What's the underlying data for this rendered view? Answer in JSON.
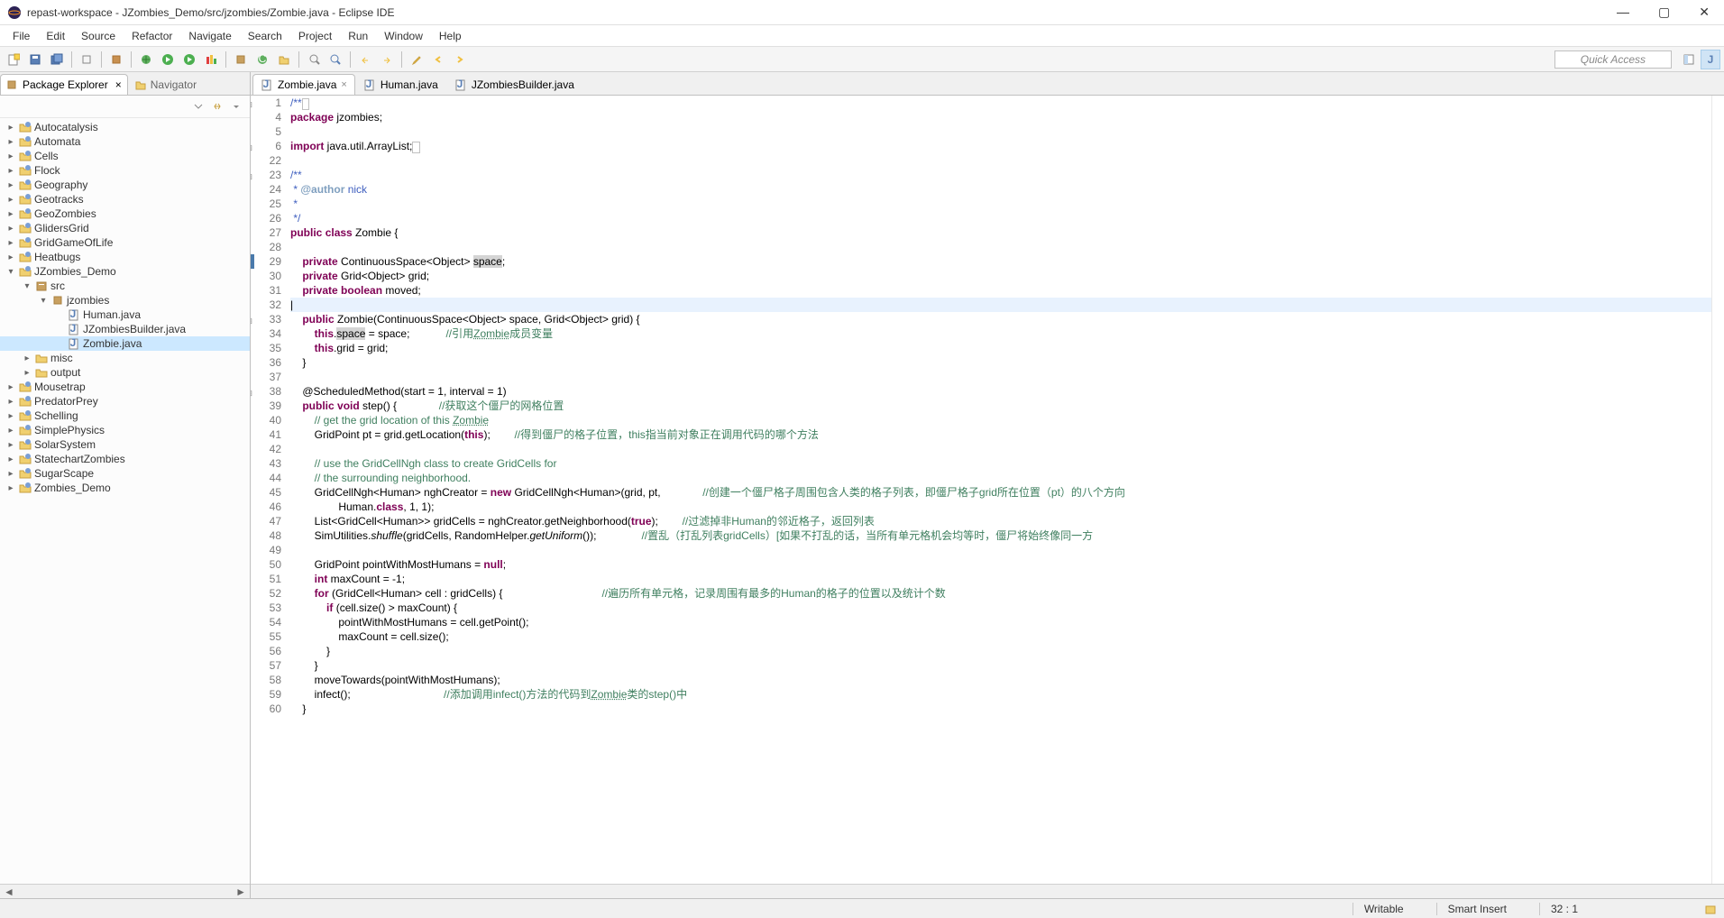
{
  "window": {
    "title": "repast-workspace - JZombies_Demo/src/jzombies/Zombie.java - Eclipse IDE"
  },
  "menu": [
    "File",
    "Edit",
    "Source",
    "Refactor",
    "Navigate",
    "Search",
    "Project",
    "Run",
    "Window",
    "Help"
  ],
  "quick_access": "Quick Access",
  "sidebar": {
    "tabs": [
      {
        "label": "Package Explorer",
        "active": true
      },
      {
        "label": "Navigator",
        "active": false
      }
    ],
    "projects": [
      {
        "label": "Autocatalysis",
        "expanded": false,
        "depth": 0,
        "icon": "project"
      },
      {
        "label": "Automata",
        "expanded": false,
        "depth": 0,
        "icon": "project"
      },
      {
        "label": "Cells",
        "expanded": false,
        "depth": 0,
        "icon": "project"
      },
      {
        "label": "Flock",
        "expanded": false,
        "depth": 0,
        "icon": "project"
      },
      {
        "label": "Geography",
        "expanded": false,
        "depth": 0,
        "icon": "project"
      },
      {
        "label": "Geotracks",
        "expanded": false,
        "depth": 0,
        "icon": "project"
      },
      {
        "label": "GeoZombies",
        "expanded": false,
        "depth": 0,
        "icon": "project"
      },
      {
        "label": "GlidersGrid",
        "expanded": false,
        "depth": 0,
        "icon": "project"
      },
      {
        "label": "GridGameOfLife",
        "expanded": false,
        "depth": 0,
        "icon": "project"
      },
      {
        "label": "Heatbugs",
        "expanded": false,
        "depth": 0,
        "icon": "project"
      },
      {
        "label": "JZombies_Demo",
        "expanded": true,
        "depth": 0,
        "icon": "project"
      },
      {
        "label": "src",
        "expanded": true,
        "depth": 1,
        "icon": "src"
      },
      {
        "label": "jzombies",
        "expanded": true,
        "depth": 2,
        "icon": "package"
      },
      {
        "label": "Human.java",
        "expanded": null,
        "depth": 3,
        "icon": "java"
      },
      {
        "label": "JZombiesBuilder.java",
        "expanded": null,
        "depth": 3,
        "icon": "java"
      },
      {
        "label": "Zombie.java",
        "expanded": null,
        "depth": 3,
        "icon": "java",
        "selected": true
      },
      {
        "label": "misc",
        "expanded": false,
        "depth": 1,
        "icon": "folder"
      },
      {
        "label": "output",
        "expanded": false,
        "depth": 1,
        "icon": "folder"
      },
      {
        "label": "Mousetrap",
        "expanded": false,
        "depth": 0,
        "icon": "project"
      },
      {
        "label": "PredatorPrey",
        "expanded": false,
        "depth": 0,
        "icon": "project"
      },
      {
        "label": "Schelling",
        "expanded": false,
        "depth": 0,
        "icon": "project"
      },
      {
        "label": "SimplePhysics",
        "expanded": false,
        "depth": 0,
        "icon": "project"
      },
      {
        "label": "SolarSystem",
        "expanded": false,
        "depth": 0,
        "icon": "project"
      },
      {
        "label": "StatechartZombies",
        "expanded": false,
        "depth": 0,
        "icon": "project"
      },
      {
        "label": "SugarScape",
        "expanded": false,
        "depth": 0,
        "icon": "project"
      },
      {
        "label": "Zombies_Demo",
        "expanded": false,
        "depth": 0,
        "icon": "project"
      }
    ]
  },
  "editor": {
    "tabs": [
      {
        "label": "Zombie.java",
        "active": true
      },
      {
        "label": "Human.java",
        "active": false
      },
      {
        "label": "JZombiesBuilder.java",
        "active": false
      }
    ],
    "lines": [
      {
        "n": "1",
        "fold": "+",
        "html": "<span class='jd'>/**</span><span class='fd'>&nbsp;</span>"
      },
      {
        "n": "4",
        "html": "<span class='kw'>package</span> jzombies;"
      },
      {
        "n": "5",
        "html": ""
      },
      {
        "n": "6",
        "fold": "+",
        "html": "<span class='kw'>import</span> java.util.ArrayList;<span class='fd'>&nbsp;</span>"
      },
      {
        "n": "22",
        "html": ""
      },
      {
        "n": "23",
        "fold": "-",
        "html": "<span class='jd'>/**</span>"
      },
      {
        "n": "24",
        "html": "<span class='jd'> * </span><span class='jtag'>@author</span><span class='jd'> nick</span>"
      },
      {
        "n": "25",
        "html": "<span class='jd'> *</span>"
      },
      {
        "n": "26",
        "html": "<span class='jd'> */</span>"
      },
      {
        "n": "27",
        "html": "<span class='kw'>public</span> <span class='kw'>class</span> Zombie {"
      },
      {
        "n": "28",
        "html": ""
      },
      {
        "n": "29",
        "ovw": true,
        "html": "    <span class='kw'>private</span> ContinuousSpace&lt;Object&gt; <span class='hl'>space</span>;"
      },
      {
        "n": "30",
        "html": "    <span class='kw'>private</span> Grid&lt;Object&gt; grid;"
      },
      {
        "n": "31",
        "warn": true,
        "html": "    <span class='kw'>private</span> <span class='kw'>boolean</span> moved;"
      },
      {
        "n": "32",
        "current": true,
        "html": "|"
      },
      {
        "n": "33",
        "fold": "-",
        "html": "    <span class='kw'>public</span> Zombie(ContinuousSpace&lt;Object&gt; space, Grid&lt;Object&gt; grid) {"
      },
      {
        "n": "34",
        "html": "        <span class='kw'>this</span>.<span class='hl'>space</span> = space;            <span class='cm'>//引用<span class='un'>Zombie</span>成员变量</span>"
      },
      {
        "n": "35",
        "html": "        <span class='kw'>this</span>.grid = grid;"
      },
      {
        "n": "36",
        "html": "    }"
      },
      {
        "n": "37",
        "html": ""
      },
      {
        "n": "38",
        "fold": "-",
        "html": "    @ScheduledMethod(start = 1, interval = 1)"
      },
      {
        "n": "39",
        "html": "    <span class='kw'>public</span> <span class='kw'>void</span> step() {              <span class='cm'>//获取这个僵尸的网格位置</span>"
      },
      {
        "n": "40",
        "html": "        <span class='cm'>// get the grid location of this <span class='un'>Zombie</span></span>"
      },
      {
        "n": "41",
        "html": "        GridPoint pt = grid.getLocation(<span class='kw'>this</span>);        <span class='cm'>//得到僵尸的格子位置，this指当前对象正在调用代码的哪个方法</span>"
      },
      {
        "n": "42",
        "html": ""
      },
      {
        "n": "43",
        "html": "        <span class='cm'>// use the GridCellNgh class to create GridCells for</span>"
      },
      {
        "n": "44",
        "html": "        <span class='cm'>// the surrounding neighborhood.</span>"
      },
      {
        "n": "45",
        "html": "        GridCellNgh&lt;Human&gt; nghCreator = <span class='kw'>new</span> GridCellNgh&lt;Human&gt;(grid, pt,              <span class='cm'>//创建一个僵尸格子周围包含人类的格子列表，即僵尸格子grid所在位置（pt）的八个方向</span>"
      },
      {
        "n": "46",
        "html": "                Human.<span class='kw'>class</span>, 1, 1);"
      },
      {
        "n": "47",
        "html": "        List&lt;GridCell&lt;Human&gt;&gt; gridCells = nghCreator.getNeighborhood(<span class='kw'>true</span>);        <span class='cm'>//过滤掉非Human的邻近格子，返回列表</span>"
      },
      {
        "n": "48",
        "html": "        SimUtilities.<i>shuffle</i>(gridCells, RandomHelper.<i>getUniform</i>());               <span class='cm'>//置乱（打乱列表gridCells）[如果不打乱的话，当所有单元格机会均等时，僵尸将始终像同一方</span>"
      },
      {
        "n": "49",
        "html": ""
      },
      {
        "n": "50",
        "html": "        GridPoint pointWithMostHumans = <span class='kw'>null</span>;"
      },
      {
        "n": "51",
        "html": "        <span class='kw'>int</span> maxCount = -1;"
      },
      {
        "n": "52",
        "html": "        <span class='kw'>for</span> (GridCell&lt;Human&gt; cell : gridCells) {                                 <span class='cm'>//遍历所有单元格，记录周围有最多的Human的格子的位置以及统计个数</span>"
      },
      {
        "n": "53",
        "html": "            <span class='kw'>if</span> (cell.size() &gt; maxCount) {"
      },
      {
        "n": "54",
        "html": "                pointWithMostHumans = cell.getPoint();"
      },
      {
        "n": "55",
        "html": "                maxCount = cell.size();"
      },
      {
        "n": "56",
        "html": "            }"
      },
      {
        "n": "57",
        "html": "        }"
      },
      {
        "n": "58",
        "html": "        moveTowards(pointWithMostHumans);"
      },
      {
        "n": "59",
        "html": "        infect();                               <span class='cm'>//添加调用infect()方法的代码到<span class='un'>Zombie</span>类的step()中</span>"
      },
      {
        "n": "60",
        "html": "    }"
      }
    ]
  },
  "status": {
    "writable": "Writable",
    "insert": "Smart Insert",
    "position": "32 : 1"
  }
}
